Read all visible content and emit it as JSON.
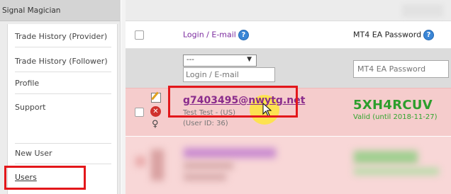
{
  "sidebar": {
    "title": "Signal Magician",
    "items": [
      {
        "label": "Trade History (Provider)"
      },
      {
        "label": "Trade History (Follower)"
      },
      {
        "label": "Profile"
      },
      {
        "label": "Support"
      },
      {
        "label": "New User"
      },
      {
        "label": "Users"
      }
    ]
  },
  "table": {
    "columns": {
      "login": "Login / E-mail",
      "password": "MT4 EA Password",
      "help_icon": "?"
    },
    "filter": {
      "select_value": "---",
      "login_placeholder": "Login / E-mail",
      "password_placeholder": "MT4 EA Password"
    },
    "rows": [
      {
        "email": "g7403495@nwytg.net",
        "name": "Test Test - (US)",
        "user_id": "(User ID: 36)",
        "password": "5XH4RCUV",
        "valid": "Valid (until 2018-11-27)"
      }
    ]
  },
  "icons": {
    "edit": "edit-icon",
    "delete": "delete-icon",
    "delete_glyph": "✕",
    "award": "award-icon",
    "award_glyph": "♀",
    "caret": "▼"
  },
  "colors": {
    "highlight_box": "#e3171b",
    "row_error_bg": "#f5cccc",
    "email_link": "#8a2c8c",
    "password_green": "#2d9e2d",
    "column_label_purple": "#7b2a9e"
  }
}
